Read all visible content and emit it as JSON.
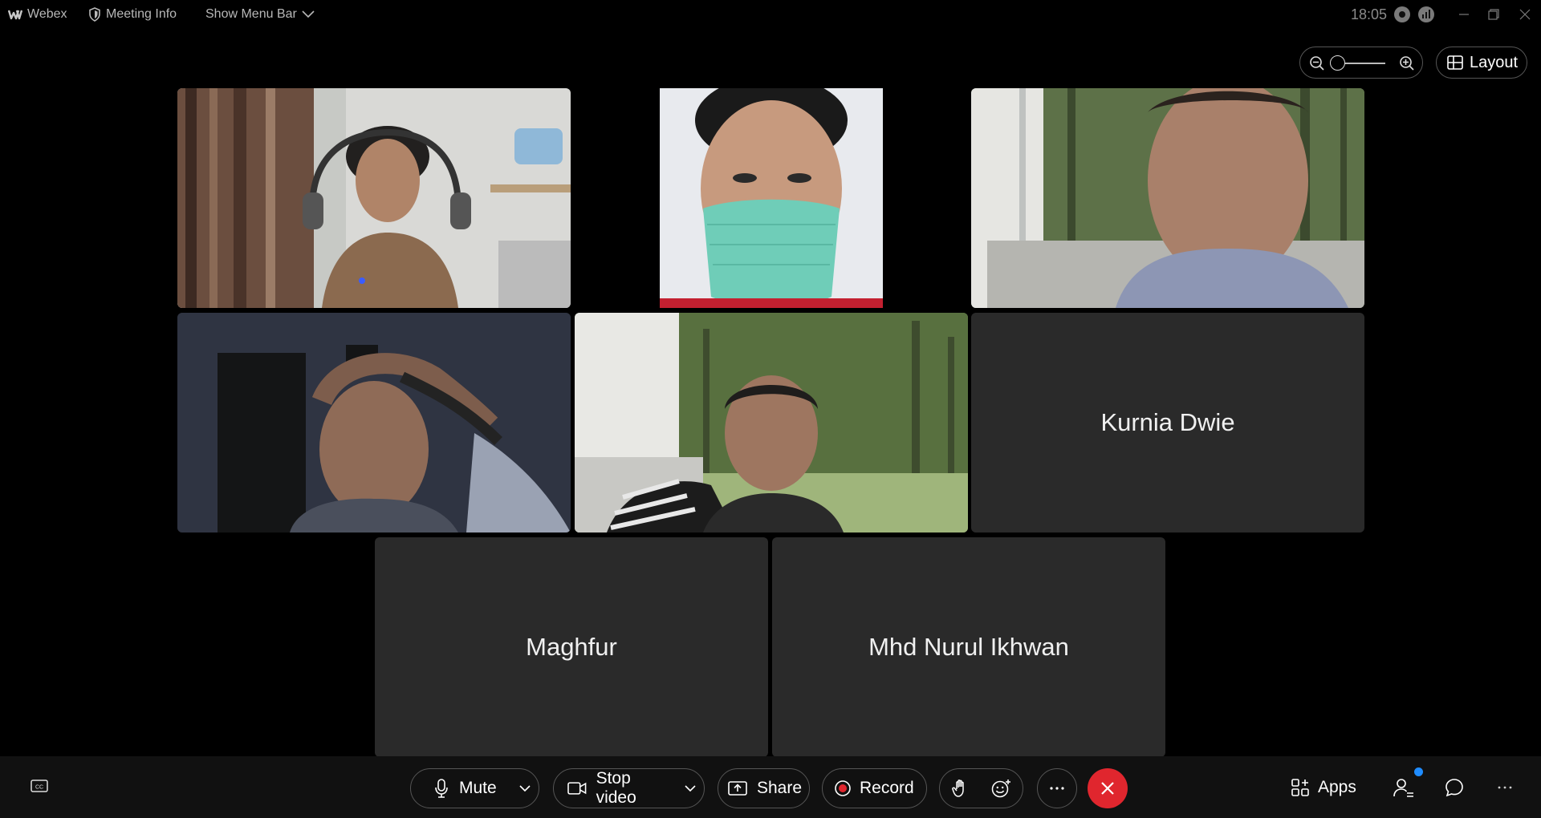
{
  "titlebar": {
    "app_name": "Webex",
    "meeting_info": "Meeting Info",
    "show_menu_bar": "Show Menu Bar",
    "time": "18:05"
  },
  "toolbar_top": {
    "layout_label": "Layout"
  },
  "participants": [
    {
      "name": "",
      "video": true
    },
    {
      "name": "",
      "video": true
    },
    {
      "name": "",
      "video": true
    },
    {
      "name": "",
      "video": true
    },
    {
      "name": "",
      "video": true
    },
    {
      "name": "Kurnia Dwie",
      "video": false
    },
    {
      "name": "Maghfur",
      "video": false
    },
    {
      "name": "Mhd Nurul Ikhwan",
      "video": false
    }
  ],
  "controls": {
    "mute_label": "Mute",
    "stop_video_label": "Stop video",
    "share_label": "Share",
    "record_label": "Record",
    "apps_label": "Apps"
  },
  "colors": {
    "end_call": "#e0262e",
    "badge": "#1f8cff",
    "tile_bg": "#2a2a2a"
  }
}
